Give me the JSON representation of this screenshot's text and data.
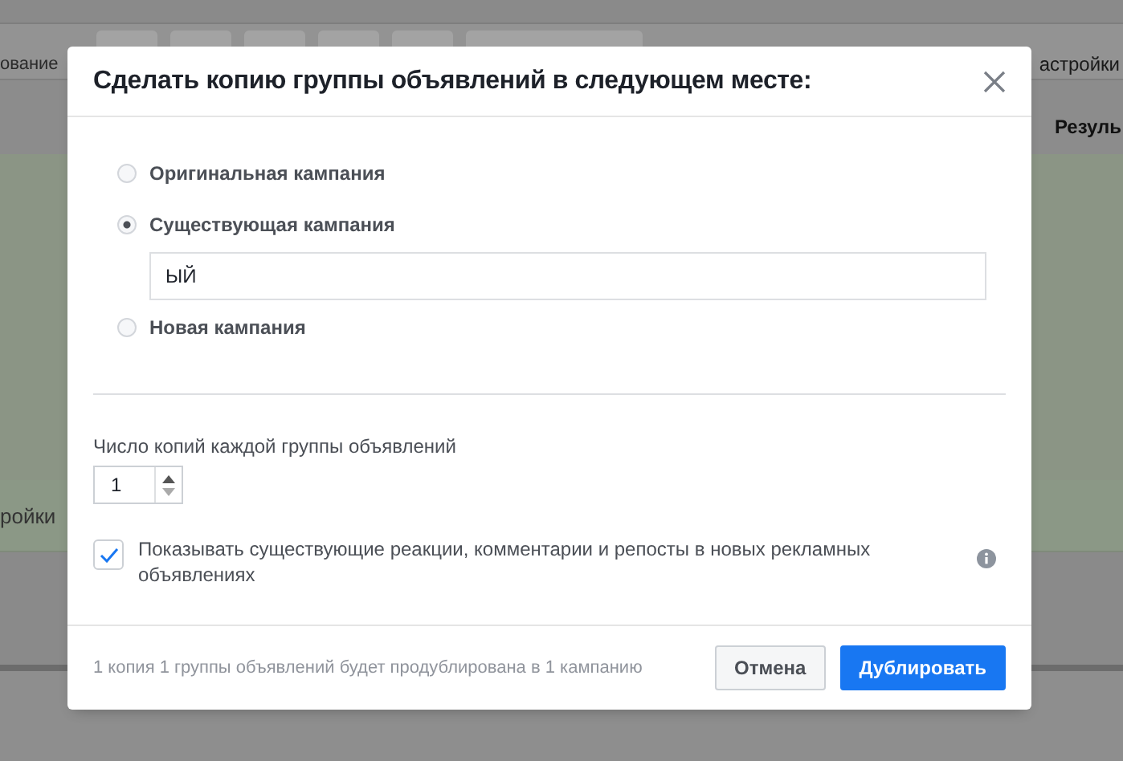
{
  "background": {
    "toolbar_left_text": "ование",
    "toolbar_right_text": "астройки",
    "column_header": "Резуль",
    "row_text": "ройки"
  },
  "dialog": {
    "title": "Сделать копию группы объявлений в следующем месте:",
    "destinations": [
      {
        "label": "Оригинальная кампания",
        "selected": false
      },
      {
        "label": "Существующая кампания",
        "selected": true,
        "field_value": "ЫЙ"
      },
      {
        "label": "Новая кампания",
        "selected": false
      }
    ],
    "copies_label": "Число копий каждой группы объявлений",
    "copies_value": "1",
    "show_reactions": {
      "label": "Показывать существующие реакции, комментарии и репосты в новых рекламных объявлениях",
      "checked": true
    },
    "summary": "1 копия 1 группы объявлений будет продублирована в 1 кампанию",
    "buttons": [
      {
        "label": "Отмена",
        "kind": "secondary"
      },
      {
        "label": "Дублировать",
        "kind": "primary"
      }
    ]
  }
}
